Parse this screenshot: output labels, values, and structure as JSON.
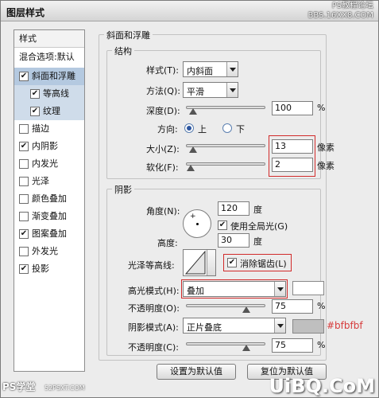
{
  "window": {
    "title": "图层样式"
  },
  "watermark_top": {
    "line1": "PS教程论坛",
    "line2": "BBS.16XX8.COM"
  },
  "left_panel": {
    "header": "样式",
    "blend": "混合选项:默认",
    "items": [
      {
        "label": "斜面和浮雕",
        "checked": "✔"
      },
      {
        "label": "等高线",
        "checked": "✔"
      },
      {
        "label": "纹理",
        "checked": "✔"
      },
      {
        "label": "描边",
        "checked": ""
      },
      {
        "label": "内阴影",
        "checked": "✔"
      },
      {
        "label": "内发光",
        "checked": ""
      },
      {
        "label": "光泽",
        "checked": ""
      },
      {
        "label": "颜色叠加",
        "checked": ""
      },
      {
        "label": "渐变叠加",
        "checked": ""
      },
      {
        "label": "图案叠加",
        "checked": "✔"
      },
      {
        "label": "外发光",
        "checked": ""
      },
      {
        "label": "投影",
        "checked": "✔"
      }
    ]
  },
  "bevel": {
    "section_title": "斜面和浮雕",
    "structure_title": "结构",
    "style_label": "样式(T):",
    "style_value": "内斜面",
    "technique_label": "方法(Q):",
    "technique_value": "平滑",
    "depth_label": "深度(D):",
    "depth_value": "100",
    "depth_unit": "%",
    "direction_label": "方向:",
    "dir_up": "上",
    "dir_down": "下",
    "size_label": "大小(Z):",
    "size_value": "13",
    "size_unit": "像素",
    "soften_label": "软化(F):",
    "soften_value": "2",
    "soften_unit": "像素"
  },
  "shading": {
    "title": "阴影",
    "angle_label": "角度(N):",
    "angle_value": "120",
    "angle_unit": "度",
    "global_light": "使用全局光(G)",
    "altitude_label": "高度:",
    "altitude_value": "30",
    "altitude_unit": "度",
    "gloss_label": "光泽等高线:",
    "antialias": "消除锯齿(L)",
    "highlight_mode_label": "高光模式(H):",
    "highlight_mode_value": "叠加",
    "highlight_opacity_label": "不透明度(O):",
    "highlight_opacity_value": "75",
    "shadow_mode_label": "阴影模式(A):",
    "shadow_mode_value": "正片叠底",
    "shadow_color_hex": "#bfbfbf",
    "shadow_opacity_label": "不透明度(C):",
    "shadow_opacity_value": "75",
    "pct": "%"
  },
  "slider_levels": {
    "depth": 0.08,
    "size": 0.08,
    "soften": 0.05,
    "highlight_opacity": 0.75,
    "shadow_opacity": 0.75
  },
  "colors": {
    "highlight": "#ffffff",
    "shadow": "#bfbfbf",
    "accent": "#d12a2a"
  },
  "buttons": {
    "make_default": "设置为默认值",
    "reset_default": "复位为默认值"
  },
  "footer": {
    "site_mark": "PS学堂",
    "site_sub": "52PSXT.COM",
    "brand": "UiBQ.CoM"
  }
}
